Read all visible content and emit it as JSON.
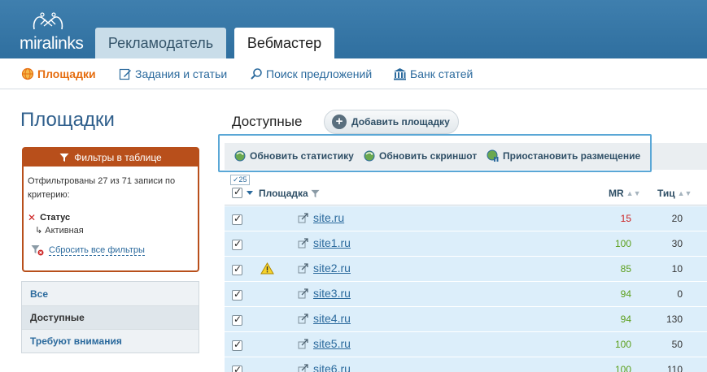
{
  "app": {
    "logo_text": "miralinks"
  },
  "tabs": [
    {
      "label": "Рекламодатель",
      "active": false
    },
    {
      "label": "Вебмастер",
      "active": true
    }
  ],
  "subnav": [
    {
      "label": "Площадки",
      "icon": "globe-icon",
      "active": true
    },
    {
      "label": "Задания и статьи",
      "icon": "edit-icon",
      "active": false
    },
    {
      "label": "Поиск предложений",
      "icon": "search-icon",
      "active": false
    },
    {
      "label": "Банк статей",
      "icon": "bank-icon",
      "active": false
    }
  ],
  "page_title": "Площадки",
  "filter": {
    "header": "Фильтры в таблице",
    "description": "Отфильтрованы 27 из 71 записи по критерию:",
    "criterion_label": "Статус",
    "criterion_value": "Активная",
    "reset_label": "Сбросить все фильтры"
  },
  "leftnav": [
    {
      "label": "Все",
      "active": false
    },
    {
      "label": "Доступные",
      "active": true
    },
    {
      "label": "Требуют внимания",
      "active": false
    }
  ],
  "section": {
    "title": "Доступные",
    "add_label": "Добавить площадку"
  },
  "toolbar": [
    {
      "label": "Обновить статистику",
      "icon": "refresh-globe-icon"
    },
    {
      "label": "Обновить скриншот",
      "icon": "refresh-globe-icon"
    },
    {
      "label": "Приостановить размещение",
      "icon": "pause-globe-icon"
    }
  ],
  "table": {
    "count_badge": "25",
    "columns": {
      "site": "Площадка",
      "mr": "MR",
      "tic": "Тиц"
    },
    "rows": [
      {
        "site": "site.ru",
        "mr": "15",
        "tic": "20",
        "warning": false,
        "mr_color": "red"
      },
      {
        "site": "site1.ru",
        "mr": "100",
        "tic": "30",
        "warning": false,
        "mr_color": "green"
      },
      {
        "site": "site2.ru",
        "mr": "85",
        "tic": "10",
        "warning": true,
        "mr_color": "green"
      },
      {
        "site": "site3.ru",
        "mr": "94",
        "tic": "0",
        "warning": false,
        "mr_color": "green"
      },
      {
        "site": "site4.ru",
        "mr": "94",
        "tic": "130",
        "warning": false,
        "mr_color": "green"
      },
      {
        "site": "site5.ru",
        "mr": "100",
        "tic": "50",
        "warning": false,
        "mr_color": "green"
      },
      {
        "site": "site6.ru",
        "mr": "100",
        "tic": "110",
        "warning": false,
        "mr_color": "green"
      }
    ]
  },
  "colors": {
    "header": "#3f7fae",
    "accent_orange": "#e56d10",
    "filter_red": "#b84f1b",
    "link_blue": "#2b6a9d",
    "row_bg": "#dceefa",
    "mr_red": "#cc2222",
    "mr_green": "#5a9e1a"
  }
}
